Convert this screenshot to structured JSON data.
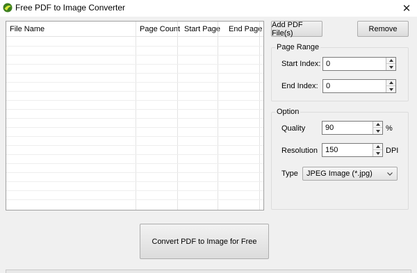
{
  "window": {
    "title": "Free PDF to Image Converter",
    "close_glyph": "✕"
  },
  "list": {
    "columns": [
      {
        "label": "File Name"
      },
      {
        "label": "Page Count"
      },
      {
        "label": "Start Page"
      },
      {
        "label": "End Page"
      }
    ]
  },
  "buttons": {
    "add": "Add PDF File(s)",
    "remove": "Remove",
    "convert": "Convert PDF to Image for Free"
  },
  "page_range": {
    "title": "Page Range",
    "start_label": "Start Index:",
    "start_value": "0",
    "end_label": "End Index:",
    "end_value": "0"
  },
  "option": {
    "title": "Option",
    "quality_label": "Quality",
    "quality_value": "90",
    "quality_unit": "%",
    "resolution_label": "Resolution",
    "resolution_value": "150",
    "resolution_unit": "DPI",
    "type_label": "Type",
    "type_value": "JPEG Image (*.jpg)"
  },
  "colors": {
    "window_bg": "#f0f0f0",
    "list_bg": "#ffffff",
    "border": "#a0a0a0"
  }
}
